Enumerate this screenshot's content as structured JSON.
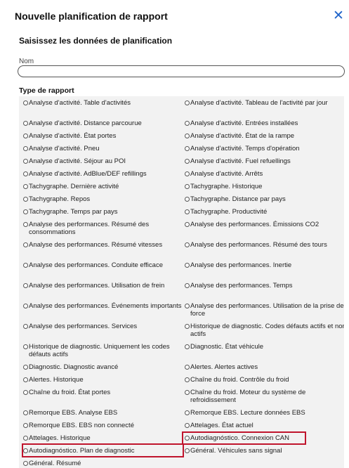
{
  "dialog": {
    "title": "Nouvelle planification de rapport",
    "close_icon": "close-icon",
    "section_title": "Saisissez les données de planification",
    "name_label": "Nom",
    "name_value": "",
    "report_type_label": "Type de rapport"
  },
  "colors": {
    "accent": "#1f63c9",
    "highlight": "#c0152d",
    "panel": "#f2f2f2"
  },
  "options": [
    "Analyse d'activité. Table d'activités",
    "Analyse d'activité. Tableau de l'activité par jour",
    "Analyse d'activité. Distance parcourue",
    "Analyse d'activité. Entrées installées",
    "Analyse d'activité. État portes",
    "Analyse d'activité. État de la rampe",
    "Analyse d'activité. Pneu",
    "Analyse d'activité. Temps d'opération",
    "Analyse d'activité. Séjour au POI",
    "Analyse d'activité. Fuel refuellings",
    "Analyse d'activité. AdBlue/DEF refillings",
    "Analyse d'activité. Arrêts",
    "Tachygraphe. Dernière activité",
    "Tachygraphe. Historique",
    "Tachygraphe. Repos",
    "Tachygraphe. Distance par pays",
    "Tachygraphe. Temps par pays",
    "Tachygraphe. Productivité",
    "Analyse des performances. Résumé des consommations",
    "Analyse des performances. Émissions CO2",
    "Analyse des performances. Résumé vitesses",
    "Analyse des performances. Résumé des tours",
    "Analyse des performances. Conduite efficace",
    "Analyse des performances. Inertie",
    "Analyse des performances. Utilisation de frein",
    "Analyse des performances. Temps",
    "Analyse des performances. Événements importants",
    "Analyse des performances. Utilisation de la prise de force",
    "Analyse des performances. Services",
    "Historique de diagnostic. Codes défauts actifs et non actifs",
    "Historique de diagnostic. Uniquement les codes défauts actifs",
    "Diagnostic. État véhicule",
    "Diagnostic. Diagnostic avancé",
    "Alertes. Alertes actives",
    "Alertes. Historique",
    "Chaîne du froid. Contrôle du froid",
    "Chaîne du froid. État portes",
    "Chaîne du froid. Moteur du système de refroidissement",
    "Remorque EBS. Analyse EBS",
    "Remorque EBS. Lecture données EBS",
    "Remorque EBS. EBS non connecté",
    "Attelages. État actuel",
    "Attelages. Historique",
    "Autodiagnóstico. Connexion CAN",
    "Autodiagnóstico. Plan de diagnostic",
    "Général. Véhicules sans signal",
    "Général. Résumé"
  ]
}
